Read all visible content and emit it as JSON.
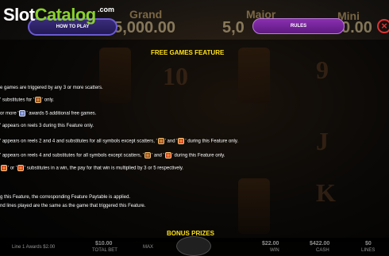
{
  "logo": {
    "slot": "Slot",
    "catalog": "Catalog",
    "com": ".com"
  },
  "jackpots": [
    {
      "label": "Grand",
      "value": "$5,000.00"
    },
    {
      "label": "Major",
      "value": "5,0"
    },
    {
      "label": "Mini",
      "value": "0.00"
    }
  ],
  "buttons": {
    "how_to_play": "HOW TO PLAY",
    "rules": "RULES",
    "close": "×"
  },
  "background_reels": {
    "symbols": [
      "10",
      "9",
      "J",
      "K"
    ]
  },
  "help": {
    "title": "FREE GAMES FEATURE",
    "lines": [
      "e games are triggered by any 3 or more scatters.",
      "' substitutes for '",
      "' only.",
      "or more '",
      "' awards 5 additional free games.",
      "' appears on reels 3 during this Feature only.",
      "' appears on reels 2 and 4 and substitutes for all symbols except scatters, '",
      "' and '",
      "' during this Feature only.",
      "' appears on reels 4 and substitutes for all symbols except scatters, '",
      "' during this Feature only.",
      "' or '",
      "' substitutes in a win, the pay for that win is multiplied by 3 or 5 respectively.",
      "g this Feature, the corresponding Feature Paytable is applied.",
      "nd lines played are the same as the game that triggered this Feature."
    ],
    "bonus_title": "BONUS PRIZES"
  },
  "bottom_bar": {
    "line_info": "Line 1 Awards $2.00",
    "total_bet_value": "$10.00",
    "total_bet_label": "TOTAL BET",
    "max_label": "MAX",
    "win_value": "$22.00",
    "win_label": "WIN",
    "cash_value": "$422.00",
    "cash_label": "CASH",
    "lines_value": "$0",
    "lines_label": "LINES"
  }
}
